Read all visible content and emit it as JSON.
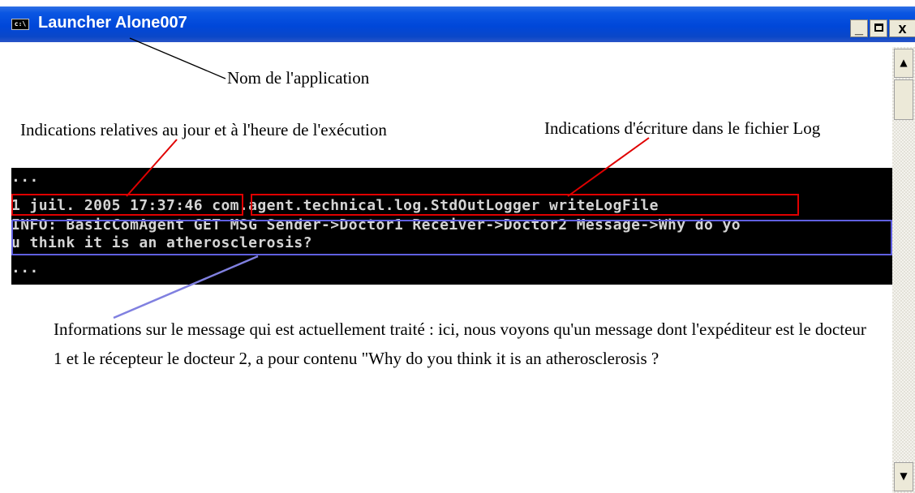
{
  "window": {
    "title": "Launcher Alone007",
    "icon_text": "c:\\",
    "minimize_label": "_",
    "close_label": "x"
  },
  "console": {
    "lines": [
      "...",
      "1 juil. 2005 17:37:46 com.agent.technical.log.StdOutLogger writeLogFile",
      "INFO: BasicComAgent GET MSG Sender->Doctor1 Receiver->Doctor2 Message->Why do yo",
      "u think it is an atherosclerosis?",
      "..."
    ]
  },
  "annotations": {
    "app_name": "Nom de l'application",
    "date_time": "Indications relatives au jour et à l'heure de l'exécution",
    "log_write": "Indications d'écriture dans le fichier Log",
    "message_info": "Informations sur le message qui est actuellement traité : ici, nous voyons qu'un message dont l'expéditeur est le docteur 1 et le récepteur le docteur 2, a pour contenu \"Why do you think it is an atherosclerosis ?"
  },
  "colors": {
    "titlebar": "#0047d9",
    "highlight_red": "#e00000",
    "highlight_blue": "#6060e0",
    "console_bg": "#000000",
    "console_text": "#d4d4d4"
  },
  "scrollbar": {
    "up_arrow": "▲",
    "down_arrow": "▼"
  }
}
